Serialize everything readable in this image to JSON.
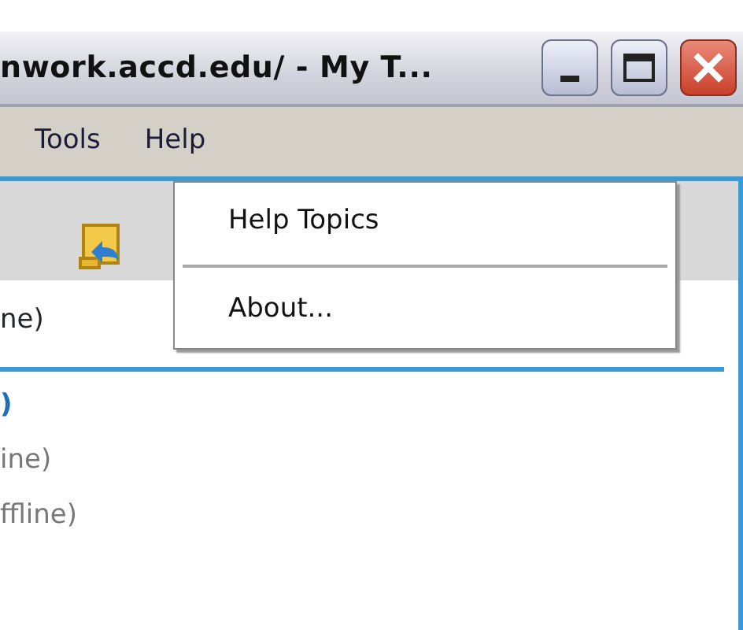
{
  "window": {
    "title": "nwork.accd.edu/ - My T..."
  },
  "menu_bar": [
    {
      "label": "Tools"
    },
    {
      "label": "Help"
    }
  ],
  "open_menu": {
    "items": [
      {
        "kind": "item",
        "label": "Help Topics"
      },
      {
        "kind": "separator"
      },
      {
        "kind": "item",
        "label": "About..."
      }
    ]
  },
  "groups": [
    {
      "items": [
        {
          "text": "ne)",
          "offline": false
        }
      ]
    },
    {
      "header": ")",
      "items": [
        {
          "text": "ine)",
          "offline": true
        },
        {
          "text": "ffline)",
          "offline": true
        }
      ]
    }
  ]
}
